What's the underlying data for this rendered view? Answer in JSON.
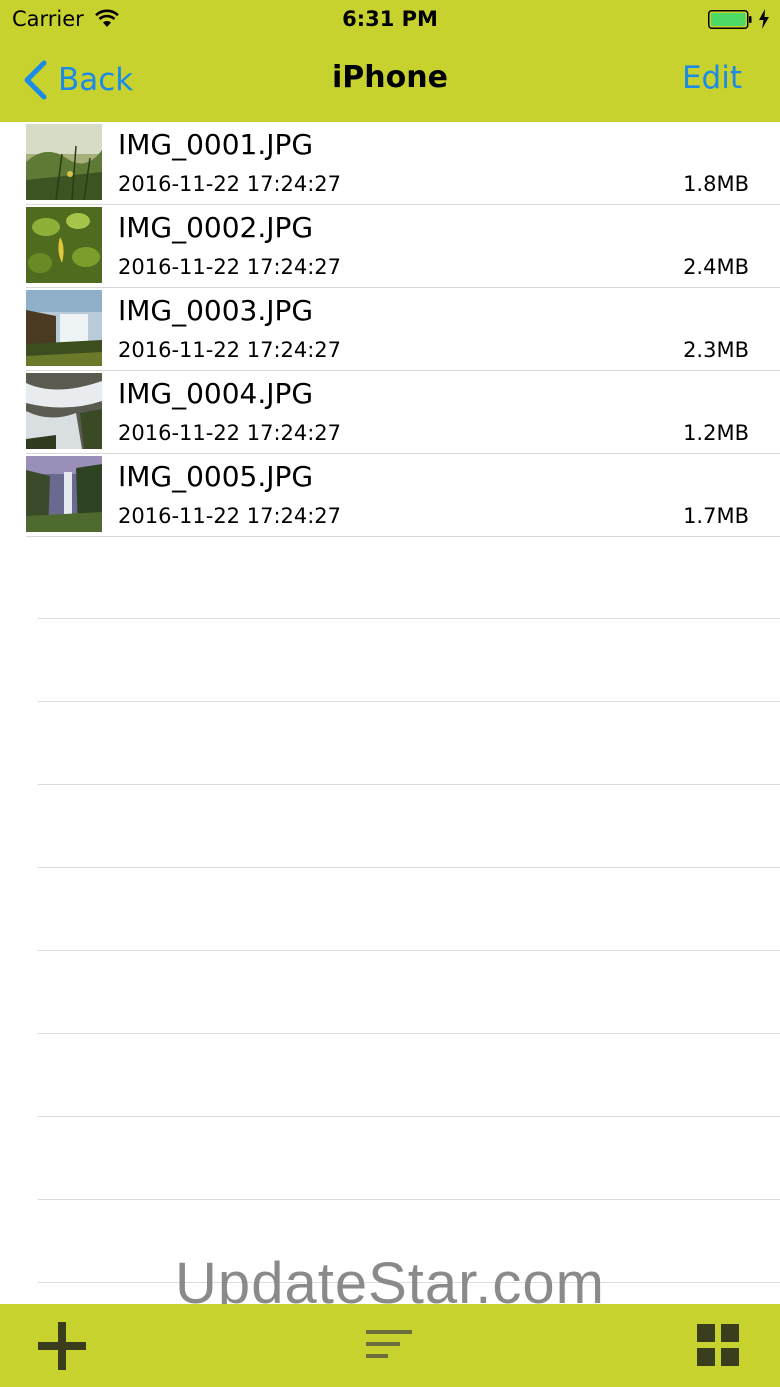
{
  "status_bar": {
    "carrier": "Carrier",
    "time": "6:31 PM"
  },
  "nav": {
    "back_label": "Back",
    "title": "iPhone",
    "edit_label": "Edit"
  },
  "files": [
    {
      "name": "IMG_0001.JPG",
      "date": "2016-11-22 17:24:27",
      "size": "1.8MB"
    },
    {
      "name": "IMG_0002.JPG",
      "date": "2016-11-22 17:24:27",
      "size": "2.4MB"
    },
    {
      "name": "IMG_0003.JPG",
      "date": "2016-11-22 17:24:27",
      "size": "2.3MB"
    },
    {
      "name": "IMG_0004.JPG",
      "date": "2016-11-22 17:24:27",
      "size": "1.2MB"
    },
    {
      "name": "IMG_0005.JPG",
      "date": "2016-11-22 17:24:27",
      "size": "1.7MB"
    }
  ],
  "watermark": "UpdateStar.com",
  "toolbar": {
    "icons": [
      "add-icon",
      "sort-icon",
      "grid-view-icon"
    ]
  },
  "colors": {
    "bar": "#c8d22e",
    "accent": "#1d8be6",
    "icon": "#3a3d1c",
    "battery": "#4cd964"
  }
}
